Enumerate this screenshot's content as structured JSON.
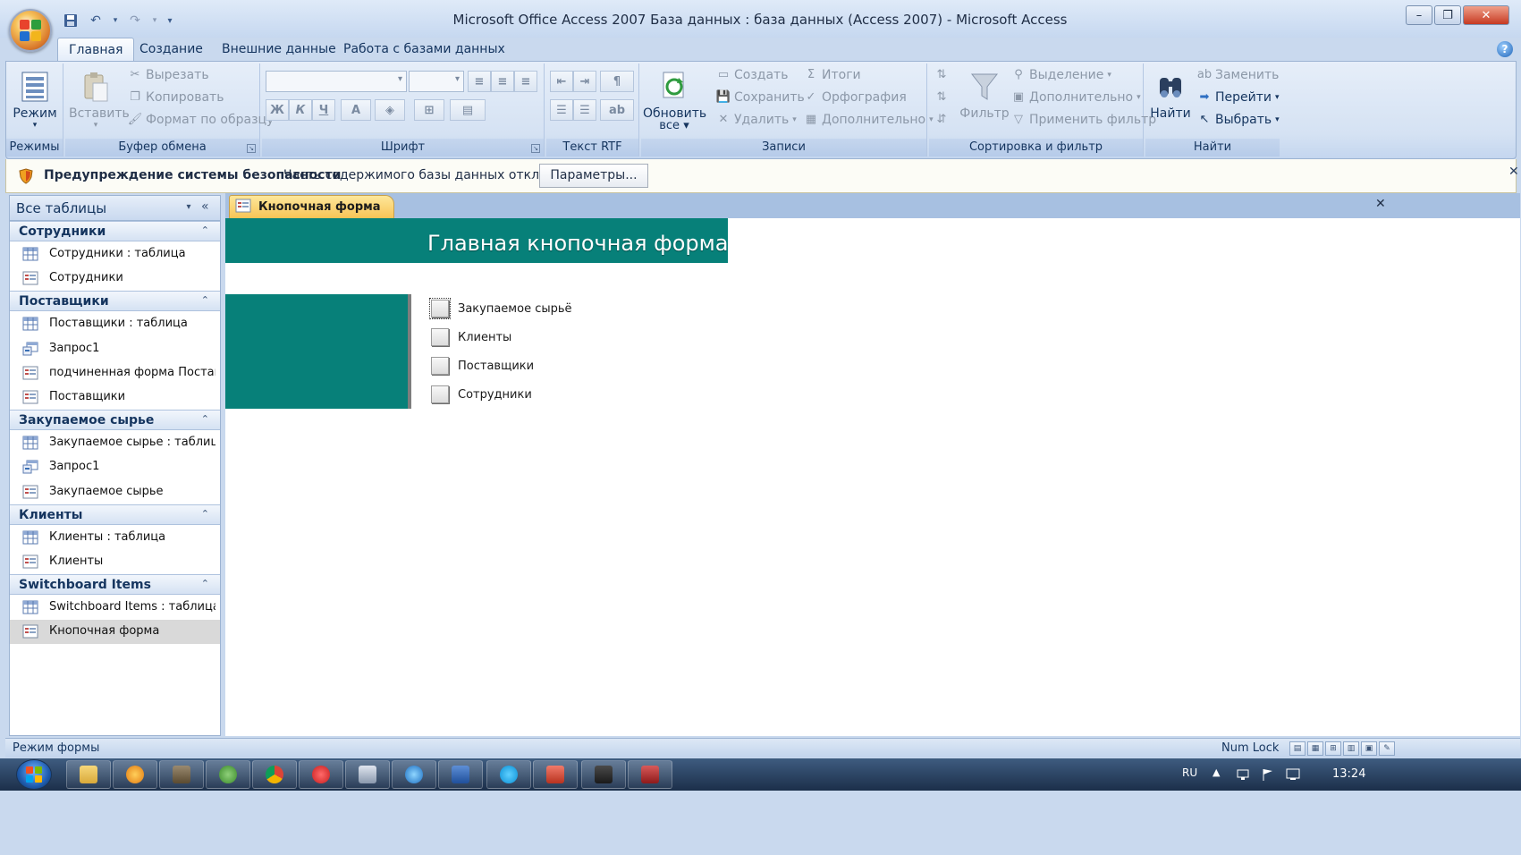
{
  "window": {
    "title": "Microsoft Office Access 2007 База данных : база данных (Access 2007) - Microsoft Access",
    "min_symbol": "–",
    "max_symbol": "❐",
    "close_symbol": "✕"
  },
  "ribbon": {
    "tabs": [
      {
        "label": "Главная",
        "active": true
      },
      {
        "label": "Создание",
        "active": false
      },
      {
        "label": "Внешние данные",
        "active": false
      },
      {
        "label": "Работа с базами данных",
        "active": false
      }
    ],
    "groups": {
      "modes": {
        "label": "Режимы",
        "mode_button": "Режим"
      },
      "clipboard": {
        "label": "Буфер обмена",
        "paste": "Вставить",
        "cut": "Вырезать",
        "copy": "Копировать",
        "format_painter": "Формат по образцу"
      },
      "font": {
        "label": "Шрифт",
        "bold": "Ж",
        "italic": "К",
        "underline": "Ч",
        "font_color": "A"
      },
      "rtf": {
        "label": "Текст RTF"
      },
      "records": {
        "label": "Записи",
        "refresh_line1": "Обновить",
        "refresh_line2": "все",
        "new": "Создать",
        "save": "Сохранить",
        "delete": "Удалить",
        "totals": "Итоги",
        "spelling": "Орфография",
        "more": "Дополнительно"
      },
      "sort_filter": {
        "label": "Сортировка и фильтр",
        "filter": "Фильтр",
        "selection": "Выделение",
        "advanced": "Дополнительно",
        "apply_filter": "Применить фильтр"
      },
      "find": {
        "label": "Найти",
        "find": "Найти",
        "replace": "Заменить",
        "goto": "Перейти",
        "select": "Выбрать"
      }
    }
  },
  "security_bar": {
    "title": "Предупреждение системы безопасности",
    "message": "Часть содержимого базы данных отключено",
    "options_button": "Параметры...",
    "close_symbol": "✕"
  },
  "nav_pane": {
    "title": "Все таблицы",
    "collapse_symbol": "«",
    "groups": [
      {
        "label": "Сотрудники",
        "items": [
          {
            "label": "Сотрудники : таблица",
            "type": "table"
          },
          {
            "label": "Сотрудники",
            "type": "form"
          }
        ]
      },
      {
        "label": "Поставщики",
        "items": [
          {
            "label": "Поставщики : таблица",
            "type": "table"
          },
          {
            "label": "Запрос1",
            "type": "query"
          },
          {
            "label": "подчиненная форма Постав...",
            "type": "form"
          },
          {
            "label": "Поставщики",
            "type": "form"
          }
        ]
      },
      {
        "label": "Закупаемое сырье",
        "items": [
          {
            "label": "Закупаемое сырье : таблица",
            "type": "table"
          },
          {
            "label": "Запрос1",
            "type": "query"
          },
          {
            "label": "Закупаемое сырье",
            "type": "form"
          }
        ]
      },
      {
        "label": "Клиенты",
        "items": [
          {
            "label": "Клиенты : таблица",
            "type": "table"
          },
          {
            "label": "Клиенты",
            "type": "form"
          }
        ]
      },
      {
        "label": "Switchboard Items",
        "items": [
          {
            "label": "Switchboard Items : таблица",
            "type": "table"
          },
          {
            "label": "Кнопочная форма",
            "type": "form",
            "selected": true
          }
        ]
      }
    ]
  },
  "document": {
    "tab_label": "Кнопочная форма",
    "close_symbol": "✕",
    "form_title": "Главная кнопочная форма",
    "switchboard_items": [
      {
        "label": "Закупаемое сырьё",
        "focused": true
      },
      {
        "label": "Клиенты",
        "focused": false
      },
      {
        "label": "Поставщики",
        "focused": false
      },
      {
        "label": "Сотрудники",
        "focused": false
      }
    ]
  },
  "status_bar": {
    "mode": "Режим формы",
    "numlock": "Num Lock"
  },
  "taskbar": {
    "language": "RU",
    "tray_arrow": "▲",
    "clock": "13:24"
  },
  "colors": {
    "form_teal": "#078079",
    "ribbon_blue": "#d5e2f3",
    "doc_tab": "#f8c456"
  }
}
